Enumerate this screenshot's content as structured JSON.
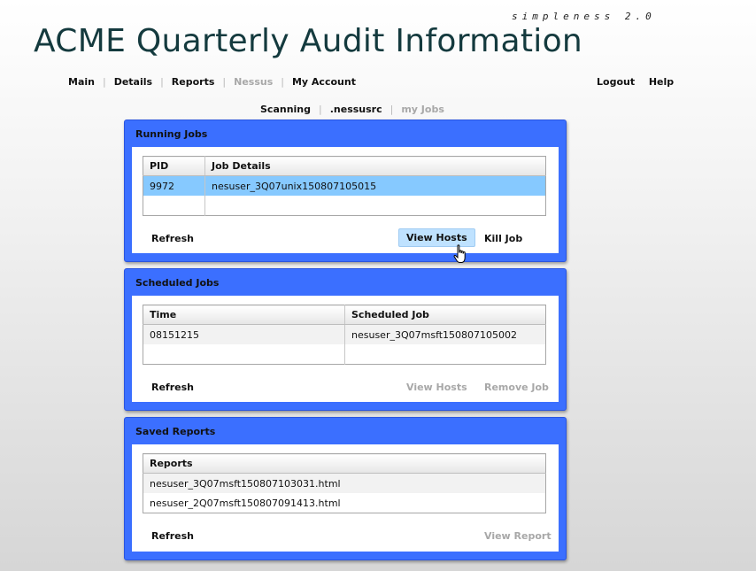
{
  "header": {
    "brand_tag": "simpleness 2.0",
    "title": "ACME Quarterly Audit Information"
  },
  "nav": {
    "main": "Main",
    "details": "Details",
    "reports": "Reports",
    "nessus": "Nessus",
    "my_account": "My Account",
    "logout": "Logout",
    "help": "Help"
  },
  "subnav": {
    "scanning": "Scanning",
    "nessusrc": ".nessusrc",
    "my_jobs": "my Jobs"
  },
  "running_jobs": {
    "title": "Running Jobs",
    "columns": [
      "PID",
      "Job Details"
    ],
    "rows": [
      {
        "pid": "9972",
        "details": "nesuser_3Q07unix150807105015"
      }
    ],
    "refresh": "Refresh",
    "view_hosts": "View Hosts",
    "kill_job": "Kill Job"
  },
  "scheduled_jobs": {
    "title": "Scheduled Jobs",
    "columns": [
      "Time",
      "Scheduled Job"
    ],
    "rows": [
      {
        "time": "08151215",
        "job": "nesuser_3Q07msft150807105002"
      }
    ],
    "refresh": "Refresh",
    "view_hosts": "View Hosts",
    "remove_job": "Remove Job"
  },
  "saved_reports": {
    "title": "Saved Reports",
    "columns": [
      "Reports"
    ],
    "rows": [
      {
        "report": "nesuser_3Q07msft150807103031.html"
      },
      {
        "report": "nesuser_2Q07msft150807091413.html"
      }
    ],
    "refresh": "Refresh",
    "view_report": "View Report"
  },
  "cursor_icon": "hand-pointer-icon",
  "colors": {
    "panel_blue": "#3b6fff",
    "selected_row": "#86c9ff",
    "title_color": "#143a3e",
    "disabled_text": "#a8a8a8"
  }
}
